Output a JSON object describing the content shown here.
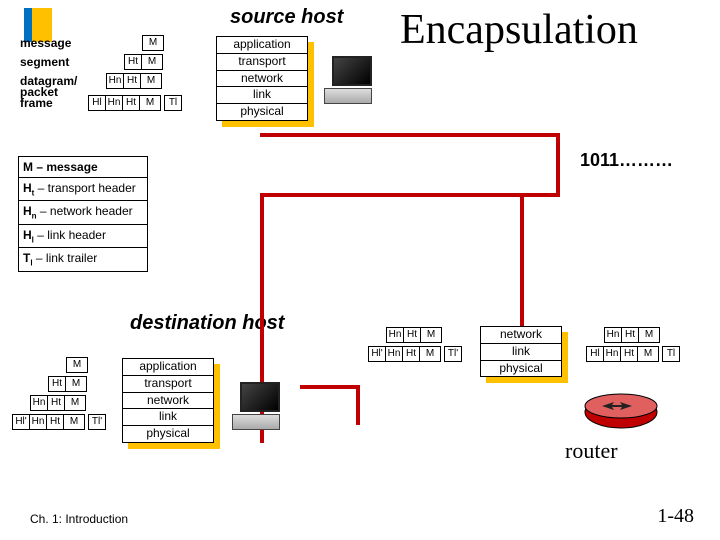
{
  "title": "Encapsulation",
  "source_host_label": "source host",
  "destination_host_label": "destination host",
  "bits_label": "1011………",
  "layers": {
    "app": "application",
    "transport": "transport",
    "network": "network",
    "link": "link",
    "physical": "physical"
  },
  "pdu_labels": {
    "message": "message",
    "segment": "segment",
    "datagram": "datagram/",
    "packet": "packet",
    "frame": "frame"
  },
  "headers": {
    "M": "M",
    "Ht": "Ht",
    "Hn": "Hn",
    "Hl": "Hl",
    "Hl_prime": "Hl'",
    "Tl": "Tl",
    "Tl_prime": "Tl'"
  },
  "legend": {
    "m": "M – message",
    "ht_a": "H",
    "ht_b": " – transport header",
    "hn_a": "H",
    "hn_b": " – network header",
    "hl_a": "H",
    "hl_b": " – link header",
    "tl_a": "T",
    "tl_b": " – link trailer"
  },
  "router_label": "router",
  "footer_chapter": "Ch. 1: Introduction",
  "slide_number": "1-48",
  "chart_data": {
    "type": "table",
    "title": "Encapsulation across network layers",
    "stacks": {
      "source_host": [
        "application",
        "transport",
        "network",
        "link",
        "physical"
      ],
      "destination_host": [
        "application",
        "transport",
        "network",
        "link",
        "physical"
      ],
      "router": [
        "network",
        "link",
        "physical"
      ]
    },
    "pdu_by_layer": [
      {
        "layer": "application",
        "name": "message",
        "fields": [
          "M"
        ]
      },
      {
        "layer": "transport",
        "name": "segment",
        "fields": [
          "Ht",
          "M"
        ]
      },
      {
        "layer": "network",
        "name": "datagram/packet",
        "fields": [
          "Hn",
          "Ht",
          "M"
        ]
      },
      {
        "layer": "link",
        "name": "frame",
        "fields": [
          "Hl",
          "Hn",
          "Ht",
          "M",
          "Tl"
        ]
      }
    ],
    "legend": {
      "M": "message",
      "Ht": "transport header",
      "Hn": "network header",
      "Hl": "link header",
      "Tl": "link trailer"
    }
  }
}
